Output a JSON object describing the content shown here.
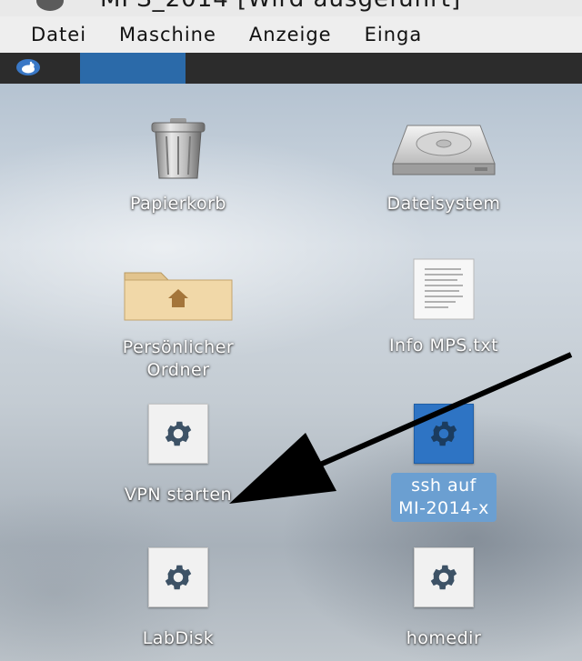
{
  "window": {
    "title": "MPS_2014 [Wird ausgeführt]"
  },
  "menubar": {
    "items": [
      "Datei",
      "Maschine",
      "Anzeige",
      "Einga"
    ]
  },
  "panel": {
    "app_menu_icon": "xfce-mouse-icon"
  },
  "desktop": {
    "icons": [
      {
        "label": "Papierkorb",
        "icon": "trash-icon"
      },
      {
        "label": "Dateisystem",
        "icon": "hard-drive-icon"
      },
      {
        "label": "Persönlicher\nOrdner",
        "icon": "home-folder-icon"
      },
      {
        "label": "Info MPS.txt",
        "icon": "text-file-icon"
      },
      {
        "label": "VPN starten",
        "icon": "gear-icon"
      },
      {
        "label": "ssh auf\nMI-2014-x",
        "icon": "gear-icon",
        "selected": true
      },
      {
        "label": "LabDisk",
        "icon": "gear-icon"
      },
      {
        "label": "homedir",
        "icon": "gear-icon"
      }
    ]
  },
  "colors": {
    "selection": "#6b9fd1",
    "panel": "#2c2c2c",
    "workspace_active": "#2b6aa9"
  }
}
